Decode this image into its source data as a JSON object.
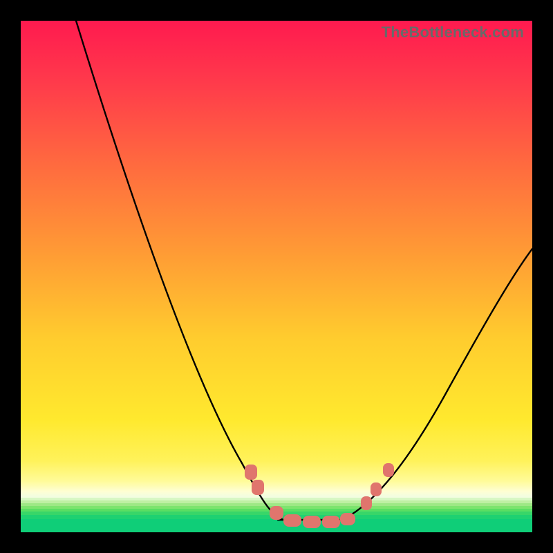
{
  "watermark": "TheBottleneck.com",
  "colors": {
    "frame_border": "#000000",
    "curve_stroke": "#000000",
    "marker_fill": "#e0756d",
    "gradient_top": "#ff1a4f",
    "gradient_mid": "#ffe92e",
    "gradient_bottom_green": "#0fce78"
  },
  "chart_data": {
    "type": "line",
    "title": "",
    "xlabel": "",
    "ylabel": "",
    "xlim": [
      0,
      100
    ],
    "ylim": [
      0,
      100
    ],
    "grid": false,
    "legend": false,
    "series": [
      {
        "name": "bottleneck-curve",
        "x": [
          11,
          18,
          28,
          38,
          43,
          47,
          51,
          55,
          59,
          63,
          67,
          72,
          80,
          90,
          100
        ],
        "y": [
          100,
          78,
          48,
          22,
          13,
          6,
          2.5,
          2.5,
          2.5,
          2.5,
          5,
          10,
          22,
          40,
          55
        ]
      }
    ],
    "markers": {
      "name": "valley-markers",
      "color": "#e0756d",
      "points_x": [
        44,
        46,
        49,
        52,
        56,
        60,
        63,
        67,
        69,
        71
      ],
      "points_y": [
        13,
        10,
        5.5,
        3,
        2.5,
        2.5,
        3,
        7,
        10,
        13
      ]
    },
    "background_gradient_vertical": {
      "0": "#ff1a4f",
      "28": "#ff6a3f",
      "62": "#ffcc2e",
      "86": "#fff25a",
      "92": "#fefed3",
      "95": "#9ee885",
      "100": "#0fce78"
    }
  }
}
